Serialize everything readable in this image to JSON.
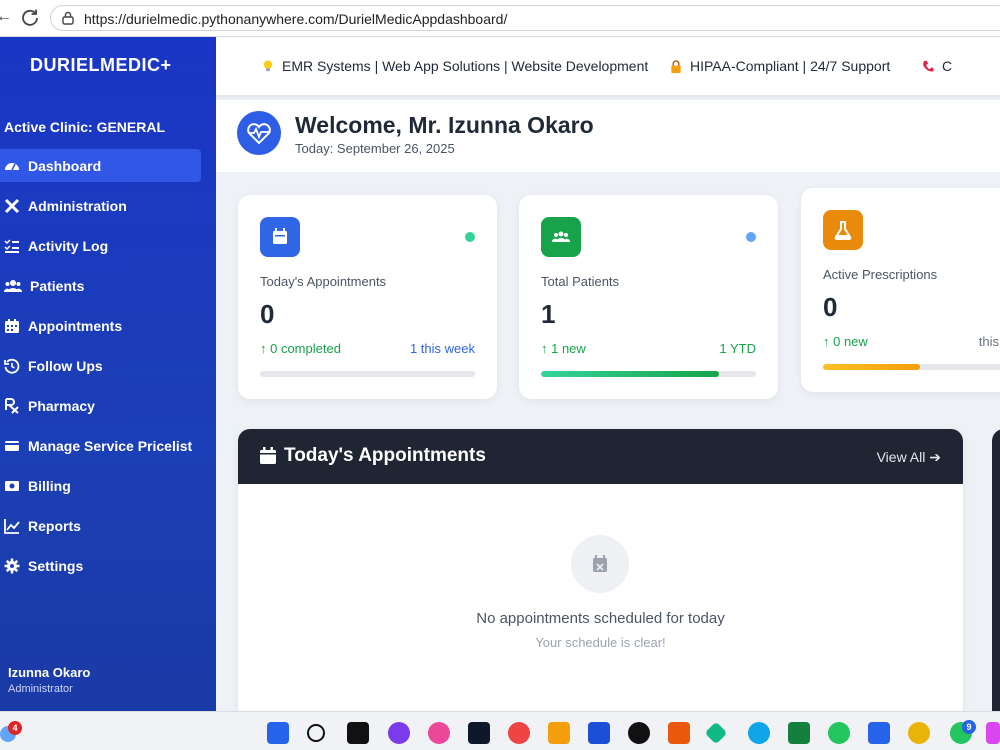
{
  "browser": {
    "url": "https://durielmedic.pythonanywhere.com/DurielMedicAppdashboard/"
  },
  "sidebar": {
    "brand": "DURIELMEDIC+",
    "active_clinic": "Active Clinic: GENERAL",
    "items": [
      {
        "label": "Dashboard",
        "icon": "gauge-icon",
        "active": true
      },
      {
        "label": "Administration",
        "icon": "tools-icon"
      },
      {
        "label": "Activity Log",
        "icon": "list-check-icon"
      },
      {
        "label": "Patients",
        "icon": "users-icon"
      },
      {
        "label": "Appointments",
        "icon": "calendar-icon"
      },
      {
        "label": "Follow Ups",
        "icon": "history-icon"
      },
      {
        "label": "Pharmacy",
        "icon": "prescription-icon"
      },
      {
        "label": "Manage Service Pricelist",
        "icon": "price-tag-icon"
      },
      {
        "label": "Billing",
        "icon": "money-bill-icon"
      },
      {
        "label": "Reports",
        "icon": "chart-line-icon"
      },
      {
        "label": "Settings",
        "icon": "gear-icon"
      }
    ],
    "user": {
      "name": "Izunna Okaro",
      "role": "Administrator"
    }
  },
  "topbar": {
    "item1": "EMR Systems | Web App Solutions | Website Development",
    "item2": "HIPAA-Compliant | 24/7 Support",
    "item3": "C"
  },
  "welcome": {
    "title": "Welcome, Mr. Izunna Okaro",
    "date": "Today: September 26, 2025"
  },
  "stats": {
    "appointments": {
      "label": "Today's Appointments",
      "value": "0",
      "left": "↑ 0 completed",
      "right": "1 this week",
      "progress": 0,
      "accent": "#2e66e6",
      "dot": "#34d399"
    },
    "patients": {
      "label": "Total Patients",
      "value": "1",
      "left": "↑ 1 new",
      "right": "1 YTD",
      "progress": 0.83,
      "accent": "#16a34a",
      "dot": "#60a5fa"
    },
    "prescriptions": {
      "label": "Active Prescriptions",
      "value": "0",
      "left": "↑ 0 new",
      "right": "this",
      "progress": 0.45,
      "accent": "#f59e0b"
    }
  },
  "appointments_panel": {
    "title": "Today's Appointments",
    "view_all": "View All",
    "empty_title": "No appointments scheduled for today",
    "empty_sub": "Your schedule is clear!"
  },
  "taskbar": {
    "weather_badge": "4",
    "whatsapp_badge": "9"
  }
}
